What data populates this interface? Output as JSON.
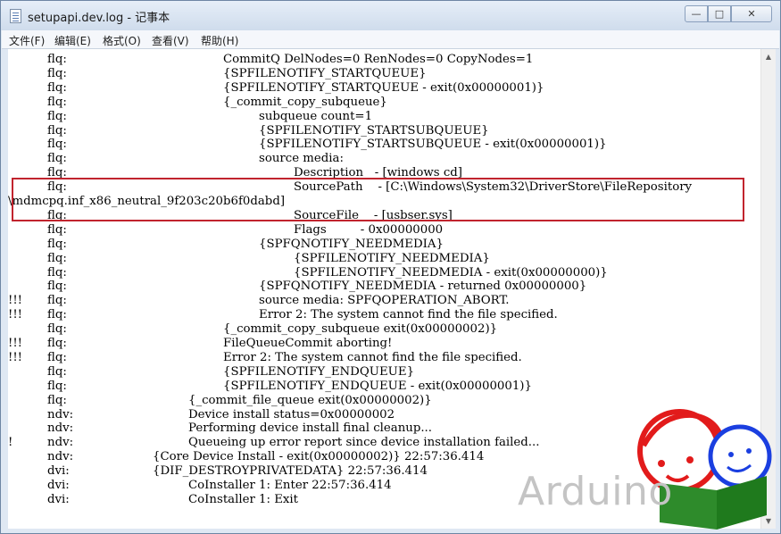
{
  "window": {
    "title": "setupapi.dev.log - 记事本",
    "minimize_glyph": "—",
    "maximize_glyph": "□",
    "close_glyph": "✕"
  },
  "menu": [
    "文件(F)",
    "编辑(E)",
    "格式(O)",
    "查看(V)",
    "帮助(H)"
  ],
  "log_lines": [
    {
      "mark": "",
      "src": "flq:",
      "indent": 5,
      "msg": "CommitQ DelNodes=0 RenNodes=0 CopyNodes=1"
    },
    {
      "mark": "",
      "src": "flq:",
      "indent": 5,
      "msg": "{SPFILENOTIFY_STARTQUEUE}"
    },
    {
      "mark": "",
      "src": "flq:",
      "indent": 5,
      "msg": "{SPFILENOTIFY_STARTQUEUE - exit(0x00000001)}"
    },
    {
      "mark": "",
      "src": "flq:",
      "indent": 5,
      "msg": "{_commit_copy_subqueue}"
    },
    {
      "mark": "",
      "src": "flq:",
      "indent": 6,
      "msg": "subqueue count=1"
    },
    {
      "mark": "",
      "src": "flq:",
      "indent": 6,
      "msg": "{SPFILENOTIFY_STARTSUBQUEUE}"
    },
    {
      "mark": "",
      "src": "flq:",
      "indent": 6,
      "msg": "{SPFILENOTIFY_STARTSUBQUEUE - exit(0x00000001)}"
    },
    {
      "mark": "",
      "src": "flq:",
      "indent": 6,
      "msg": "source media:"
    },
    {
      "mark": "",
      "src": "flq:",
      "indent": 7,
      "msg": "Description   - [windows cd]"
    },
    {
      "mark": "",
      "src": "flq:",
      "indent": 7,
      "msg": "SourcePath    - [C:\\Windows\\System32\\DriverStore\\FileRepository"
    },
    {
      "mark": "",
      "src": "",
      "indent": 0,
      "msg": "\\mdmcpq.inf_x86_neutral_9f203c20b6f0dabd]"
    },
    {
      "mark": "",
      "src": "flq:",
      "indent": 7,
      "msg": "SourceFile    - [usbser.sys]"
    },
    {
      "mark": "",
      "src": "flq:",
      "indent": 7,
      "msg": "Flags         - 0x00000000"
    },
    {
      "mark": "",
      "src": "flq:",
      "indent": 6,
      "msg": "{SPFQNOTIFY_NEEDMEDIA}"
    },
    {
      "mark": "",
      "src": "flq:",
      "indent": 7,
      "msg": "{SPFILENOTIFY_NEEDMEDIA}"
    },
    {
      "mark": "",
      "src": "flq:",
      "indent": 7,
      "msg": "{SPFILENOTIFY_NEEDMEDIA - exit(0x00000000)}"
    },
    {
      "mark": "",
      "src": "flq:",
      "indent": 6,
      "msg": "{SPFQNOTIFY_NEEDMEDIA - returned 0x00000000}"
    },
    {
      "mark": "!!!",
      "src": "flq:",
      "indent": 6,
      "msg": "source media: SPFQOPERATION_ABORT."
    },
    {
      "mark": "!!!",
      "src": "flq:",
      "indent": 6,
      "msg": "Error 2: The system cannot find the file specified."
    },
    {
      "mark": "",
      "src": "flq:",
      "indent": 5,
      "msg": "{_commit_copy_subqueue exit(0x00000002)}"
    },
    {
      "mark": "!!!",
      "src": "flq:",
      "indent": 5,
      "msg": "FileQueueCommit aborting!"
    },
    {
      "mark": "!!!",
      "src": "flq:",
      "indent": 5,
      "msg": "Error 2: The system cannot find the file specified."
    },
    {
      "mark": "",
      "src": "flq:",
      "indent": 5,
      "msg": "{SPFILENOTIFY_ENDQUEUE}"
    },
    {
      "mark": "",
      "src": "flq:",
      "indent": 5,
      "msg": "{SPFILENOTIFY_ENDQUEUE - exit(0x00000001)}"
    },
    {
      "mark": "",
      "src": "flq:",
      "indent": 4,
      "msg": "{_commit_file_queue exit(0x00000002)}"
    },
    {
      "mark": "",
      "src": "ndv:",
      "indent": 4,
      "msg": "Device install status=0x00000002"
    },
    {
      "mark": "",
      "src": "ndv:",
      "indent": 4,
      "msg": "Performing device install final cleanup..."
    },
    {
      "mark": "!",
      "src": "ndv:",
      "indent": 4,
      "msg": "Queueing up error report since device installation failed..."
    },
    {
      "mark": "",
      "src": "ndv:",
      "indent": 3,
      "msg": "{Core Device Install - exit(0x00000002)} 22:57:36.414"
    },
    {
      "mark": "",
      "src": "dvi:",
      "indent": 3,
      "msg": "{DIF_DESTROYPRIVATEDATA} 22:57:36.414"
    },
    {
      "mark": "",
      "src": "dvi:",
      "indent": 4,
      "msg": "CoInstaller 1: Enter 22:57:36.414"
    },
    {
      "mark": "",
      "src": "dvi:",
      "indent": 4,
      "msg": "CoInstaller 1: Exit"
    }
  ],
  "watermark": "Arduino"
}
